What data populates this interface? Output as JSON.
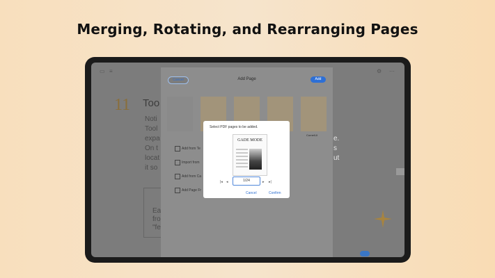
{
  "headline": "Merging, Rotating, and Rearranging Pages",
  "background_doc": {
    "chapter": "11",
    "title_fragment": "Too",
    "lines": [
      "Noti",
      "Tool",
      "expa",
      "On t",
      "locat",
      "it so"
    ],
    "right_fragments": [
      "e.",
      "s",
      "ut"
    ],
    "box_lines": [
      "Ea",
      "fro",
      "\"fe"
    ]
  },
  "add_page_panel": {
    "cancel_label": "Cancel",
    "title": "Add Page",
    "add_label": "Add",
    "template_label": "Cornell-II",
    "options": [
      "Add from Te",
      "Import from",
      "Add from Ca",
      "Add Page Fr"
    ]
  },
  "select_dialog": {
    "title": "Select PDF pages to be added.",
    "magazine_name": "GADE MODE",
    "page_value": "1/24",
    "first_icon": "|◂",
    "prev_icon": "◂",
    "next_icon": "▸",
    "last_icon": "▸|",
    "cancel_label": "Cancel",
    "confirm_label": "Confirm"
  },
  "colors": {
    "accent": "#2d6fd6",
    "background": "#f6e4cc"
  }
}
